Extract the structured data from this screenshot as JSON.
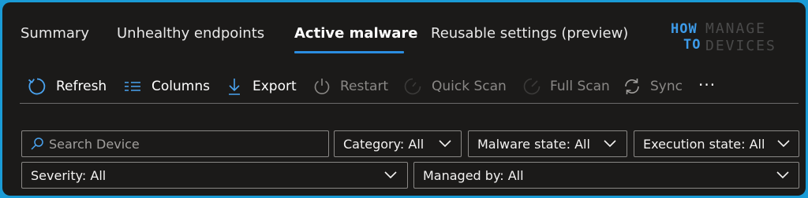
{
  "tabs": [
    {
      "label": "Summary",
      "active": false
    },
    {
      "label": "Unhealthy endpoints",
      "active": false
    },
    {
      "label": "Active malware",
      "active": true
    },
    {
      "label": "Reusable settings (preview)",
      "active": false
    }
  ],
  "logo": {
    "line1_left": "HOW",
    "line2_left": "TO",
    "line1_right": "MANAGE",
    "line2_right": "DEVICES"
  },
  "toolbar": {
    "refresh": "Refresh",
    "columns": "Columns",
    "export": "Export",
    "restart": "Restart",
    "quick_scan": "Quick Scan",
    "full_scan": "Full Scan",
    "sync": "Sync",
    "more": "···"
  },
  "filters": {
    "search_placeholder": "Search Device",
    "search_value": "",
    "category": "Category: All",
    "malware_state": "Malware state: All",
    "execution_state": "Execution state: All",
    "severity": "Severity: All",
    "managed_by": "Managed by: All"
  },
  "colors": {
    "background": "#1b1a19",
    "accent": "#2b8de0",
    "border_frame": "#1a9bd6",
    "disabled_text": "#8a8886"
  },
  "icons": {
    "refresh": "refresh-icon",
    "columns": "columns-icon",
    "export": "export-icon",
    "restart": "power-icon",
    "quick_scan": "quick-scan-icon",
    "full_scan": "full-scan-icon",
    "sync": "sync-icon",
    "search": "search-icon",
    "chevron": "chevron-down-icon"
  }
}
